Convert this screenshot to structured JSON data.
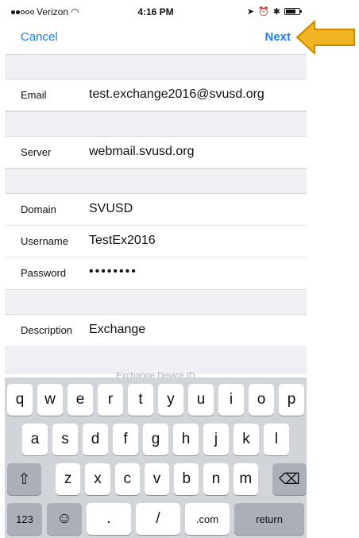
{
  "status_bar": {
    "carrier": "Verizon",
    "time": "4:16 PM",
    "signal_bars_filled": 2,
    "signal_bars_total": 5
  },
  "nav": {
    "cancel_label": "Cancel",
    "next_label": "Next"
  },
  "form": {
    "email": {
      "label": "Email",
      "value": "test.exchange2016@svusd.org"
    },
    "server": {
      "label": "Server",
      "value": "webmail.svusd.org"
    },
    "domain": {
      "label": "Domain",
      "value": "SVUSD"
    },
    "username": {
      "label": "Username",
      "value": "TestEx2016"
    },
    "password": {
      "label": "Password",
      "value": "••••••••"
    },
    "description": {
      "label": "Description",
      "value": "Exchange"
    },
    "footer_hint": "Exchange Device ID"
  },
  "keyboard": {
    "row1": [
      "q",
      "w",
      "e",
      "r",
      "t",
      "y",
      "u",
      "i",
      "o",
      "p"
    ],
    "row2": [
      "a",
      "s",
      "d",
      "f",
      "g",
      "h",
      "j",
      "k",
      "l"
    ],
    "row3": [
      "z",
      "x",
      "c",
      "v",
      "b",
      "n",
      "m"
    ],
    "shift_icon": "⇧",
    "delete_icon": "⌫",
    "numbers_label": "123",
    "emoji_icon": "☺",
    "dot_label": ".",
    "slash_label": "/",
    "dotcom_label": ".com",
    "return_label": "return"
  },
  "annotation": {
    "arrow_color": "#f2b423"
  }
}
